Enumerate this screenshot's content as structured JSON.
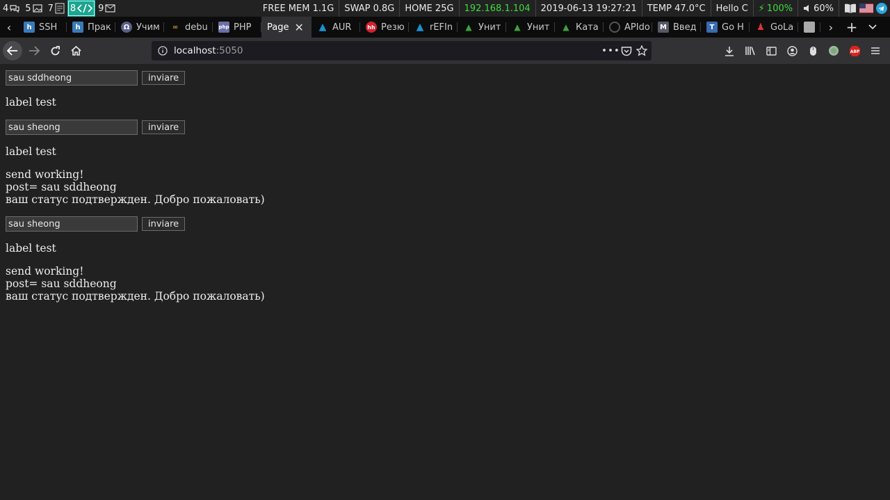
{
  "sysbar": {
    "workspaces": [
      {
        "num": "4",
        "icon": "chat-icon"
      },
      {
        "num": "5",
        "icon": "image-icon"
      },
      {
        "num": "7",
        "icon": "file-icon"
      },
      {
        "num": "8",
        "icon": "code-icon",
        "active": true
      },
      {
        "num": "9",
        "icon": "mail-icon"
      }
    ],
    "mem": "FREE MEM 1.1G",
    "swap": "SWAP 0.8G",
    "home": "HOME 25G",
    "ip": "192.168.1.104",
    "datetime": "2019-06-13 19:27:21",
    "temp": "TEMP 47.0°C",
    "greeting": "Hello C",
    "battery": "100%",
    "volume": "60%"
  },
  "tabs": [
    {
      "label": "SSH",
      "favicon": "h",
      "color": "#3a7ab8"
    },
    {
      "label": "Прак",
      "favicon": "h",
      "color": "#3a7ab8"
    },
    {
      "label": "Учим",
      "favicon": "gh",
      "color": "#5a5f8a"
    },
    {
      "label": "debu",
      "favicon": "glasses",
      "color": "#c79a27"
    },
    {
      "label": "PHP",
      "favicon": "php",
      "color": "#6a6fa6"
    },
    {
      "label": "Page",
      "active": true
    },
    {
      "label": "AUR",
      "favicon": "arch",
      "color": "#1793d1"
    },
    {
      "label": "Резю",
      "favicon": "hh",
      "color": "#d3212d"
    },
    {
      "label": "rEFIn",
      "favicon": "arch",
      "color": "#1793d1"
    },
    {
      "label": "Унит",
      "favicon": "tri",
      "color": "#3aa33a"
    },
    {
      "label": "Унит",
      "favicon": "tri",
      "color": "#3aa33a"
    },
    {
      "label": "Ката",
      "favicon": "tri",
      "color": "#3aa33a"
    },
    {
      "label": "APIdo",
      "favicon": "circle",
      "color": "#666"
    },
    {
      "label": "Введ",
      "favicon": "m",
      "color": "#555a66"
    },
    {
      "label": "Go H",
      "favicon": "t",
      "color": "#3a6ab0"
    },
    {
      "label": "GoLa",
      "favicon": "person",
      "color": "#c33"
    },
    {
      "label": "",
      "favicon": "doc",
      "color": "#999"
    }
  ],
  "nav": {
    "url_host": "localhost",
    "url_port": ":5050"
  },
  "page": {
    "forms": [
      {
        "value": "sau sddheong",
        "button": "inviare",
        "label": "label test"
      },
      {
        "value": "sau sheong",
        "button": "inviare",
        "label": "label test"
      },
      {
        "value": "sau sheong",
        "button": "inviare",
        "label": "label test"
      }
    ],
    "responses": [
      {
        "line1": "send working!",
        "line2": "post= sau sddheong",
        "line3": "ваш статус подтвержден. Добро пожаловать)"
      },
      {
        "line1": "send working!",
        "line2": "post= sau sddheong",
        "line3": "ваш статус подтвержден. Добро пожаловать)"
      }
    ]
  }
}
